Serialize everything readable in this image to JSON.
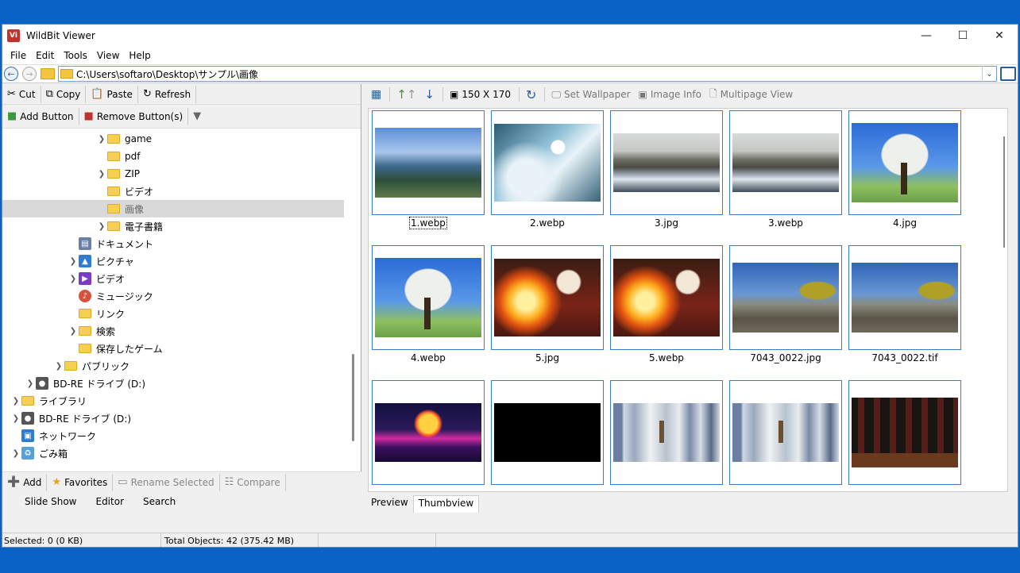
{
  "window": {
    "title": "WildBit Viewer",
    "icon_text": "Vi"
  },
  "menu": [
    "File",
    "Edit",
    "Tools",
    "View",
    "Help"
  ],
  "address": {
    "path": "C:\\Users\\softaro\\Desktop\\サンプル\\画像"
  },
  "left_toolbar": {
    "cut": "Cut",
    "copy": "Copy",
    "paste": "Paste",
    "refresh": "Refresh"
  },
  "buttons_toolbar": {
    "add_button": "Add Button",
    "remove_button": "Remove Button(s)"
  },
  "tree": [
    {
      "label": "game",
      "type": "folder",
      "expander": true
    },
    {
      "label": "pdf",
      "type": "folder",
      "expander": false
    },
    {
      "label": "ZIP",
      "type": "folder",
      "expander": true
    },
    {
      "label": "ビデオ",
      "type": "folder",
      "expander": false
    },
    {
      "label": "画像",
      "type": "folder",
      "expander": false,
      "selected": true
    },
    {
      "label": "電子書籍",
      "type": "folder",
      "expander": true
    },
    {
      "label": "ドキュメント",
      "type": "documents",
      "expander": false
    },
    {
      "label": "ピクチャ",
      "type": "pictures",
      "expander": true
    },
    {
      "label": "ビデオ",
      "type": "videos",
      "expander": true
    },
    {
      "label": "ミュージック",
      "type": "music",
      "expander": false
    },
    {
      "label": "リンク",
      "type": "folder",
      "expander": false
    },
    {
      "label": "検索",
      "type": "folder",
      "expander": true
    },
    {
      "label": "保存したゲーム",
      "type": "folder",
      "expander": false
    },
    {
      "label": "パブリック",
      "type": "folder",
      "expander": true
    },
    {
      "label": "BD-RE ドライブ (D:)",
      "type": "drive",
      "expander": true
    },
    {
      "label": "ライブラリ",
      "type": "folder",
      "expander": true
    },
    {
      "label": "BD-RE ドライブ (D:)",
      "type": "drive",
      "expander": true
    },
    {
      "label": "ネットワーク",
      "type": "network",
      "expander": false
    },
    {
      "label": "ごみ箱",
      "type": "recycle",
      "expander": true
    }
  ],
  "bottom_toolbar": {
    "add": "Add",
    "favorites": "Favorites",
    "rename_selected": "Rename Selected",
    "compare": "Compare"
  },
  "bottom_tabs": [
    "Slide Show",
    "Editor",
    "Search"
  ],
  "right_toolbar": {
    "size": "150 X 170",
    "set_wallpaper": "Set Wallpaper",
    "image_info": "Image Info",
    "multipage_view": "Multipage View"
  },
  "thumbnails": [
    {
      "name": "1.webp",
      "art": "mountain"
    },
    {
      "name": "2.webp",
      "art": "kayak"
    },
    {
      "name": "3.jpg",
      "art": "lake"
    },
    {
      "name": "3.webp",
      "art": "lake"
    },
    {
      "name": "4.jpg",
      "art": "tree"
    },
    {
      "name": "4.webp",
      "art": "tree"
    },
    {
      "name": "5.jpg",
      "art": "fire"
    },
    {
      "name": "5.webp",
      "art": "fire"
    },
    {
      "name": "7043_0022.jpg",
      "art": "rock"
    },
    {
      "name": "7043_0022.tif",
      "art": "rock"
    },
    {
      "name": "",
      "art": "synthwave"
    },
    {
      "name": "",
      "art": "black"
    },
    {
      "name": "",
      "art": "pillars"
    },
    {
      "name": "",
      "art": "pillars"
    },
    {
      "name": "",
      "art": "wine"
    }
  ],
  "view_tabs": [
    "Preview",
    "Thumbview"
  ],
  "status": {
    "selected": "Selected: 0 (0 KB)",
    "total": "Total Objects: 42 (375.42 MB)"
  },
  "colors": {
    "accent": "#3b7dc4",
    "desktop": "#0a63c4",
    "folder": "#f8cf55"
  }
}
